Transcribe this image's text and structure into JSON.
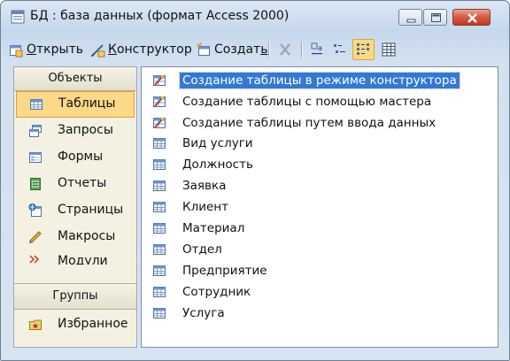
{
  "window": {
    "title": "БД : база данных (формат Access 2000)",
    "icon": "database-window-icon",
    "controls": [
      "minimize-icon",
      "maximize-icon",
      "close-icon"
    ]
  },
  "toolbar": {
    "open_label": "Открыть",
    "open_accel": "О",
    "open_rest": "ткрыть",
    "design_accel": "К",
    "design_rest": "онструктор",
    "create_accel": "Создат",
    "create_rest": "ь",
    "icons": [
      "delete-icon",
      "large-icons-view-icon",
      "small-icons-view-icon",
      "list-view-icon",
      "details-view-icon"
    ],
    "active_view": "list-view"
  },
  "objects_panel": {
    "header": "Объекты",
    "items": [
      {
        "label": "Таблицы",
        "icon": "tables-icon",
        "selected": true
      },
      {
        "label": "Запросы",
        "icon": "queries-icon",
        "selected": false
      },
      {
        "label": "Формы",
        "icon": "forms-icon",
        "selected": false
      },
      {
        "label": "Отчеты",
        "icon": "reports-icon",
        "selected": false
      },
      {
        "label": "Страницы",
        "icon": "pages-icon",
        "selected": false
      },
      {
        "label": "Макросы",
        "icon": "macros-icon",
        "selected": false
      },
      {
        "label": "Модули",
        "icon": "modules-icon",
        "selected": false
      }
    ],
    "groups_header": "Группы",
    "favorites_label": "Избранное"
  },
  "list": {
    "items": [
      {
        "label": "Создание таблицы в режиме конструктора",
        "icon": "create-wizard-icon",
        "selected": true
      },
      {
        "label": "Создание таблицы с помощью мастера",
        "icon": "create-wizard-icon",
        "selected": false
      },
      {
        "label": "Создание таблицы путем ввода данных",
        "icon": "create-wizard-icon",
        "selected": false
      },
      {
        "label": "Вид услуги",
        "icon": "table-icon",
        "selected": false
      },
      {
        "label": "Должность",
        "icon": "table-icon",
        "selected": false
      },
      {
        "label": "Заявка",
        "icon": "table-icon",
        "selected": false
      },
      {
        "label": "Клиент",
        "icon": "table-icon",
        "selected": false
      },
      {
        "label": "Материал",
        "icon": "table-icon",
        "selected": false
      },
      {
        "label": "Отдел",
        "icon": "table-icon",
        "selected": false
      },
      {
        "label": "Предприятие",
        "icon": "table-icon",
        "selected": false
      },
      {
        "label": "Сотрудник",
        "icon": "table-icon",
        "selected": false
      },
      {
        "label": "Услуга",
        "icon": "table-icon",
        "selected": false
      }
    ]
  },
  "colors": {
    "selection_blue": "#3478d4",
    "object_selected": "#fcd889",
    "window_frame": "#c6d8ec"
  }
}
